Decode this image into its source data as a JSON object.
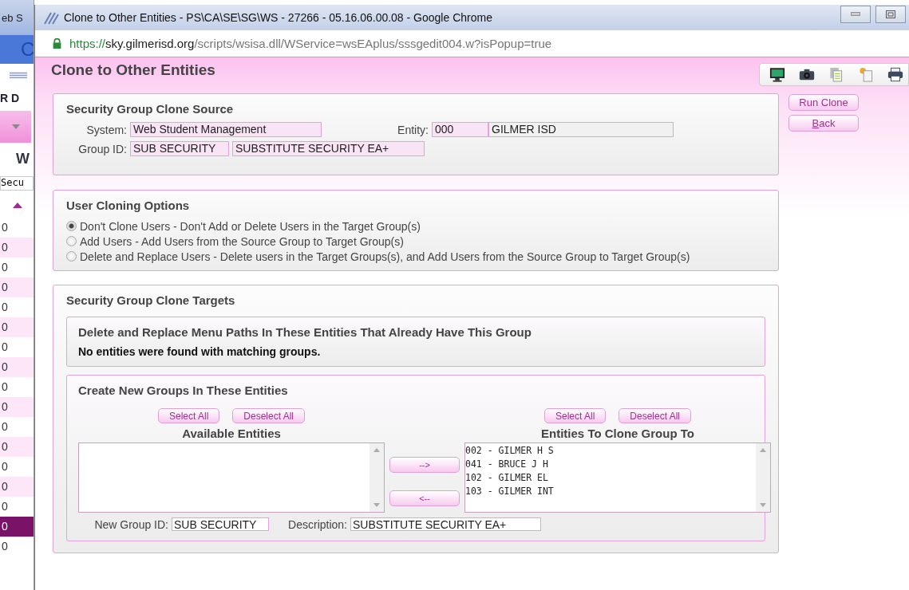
{
  "background_window": {
    "title_fragment": "eb S",
    "logo_fragment": "C",
    "heading_fragment": "R D",
    "link_fragment": "W",
    "field_fragment": "Secu",
    "rows": [
      {
        "text": "0",
        "selected": false
      },
      {
        "text": "0",
        "selected": false
      },
      {
        "text": "0",
        "selected": false
      },
      {
        "text": "0",
        "selected": false
      },
      {
        "text": "0",
        "selected": false
      },
      {
        "text": "0",
        "selected": false
      },
      {
        "text": "0",
        "selected": false
      },
      {
        "text": "0",
        "selected": false
      },
      {
        "text": "0",
        "selected": false
      },
      {
        "text": "0",
        "selected": false
      },
      {
        "text": "0",
        "selected": false
      },
      {
        "text": "0",
        "selected": false
      },
      {
        "text": "0",
        "selected": false
      },
      {
        "text": "0",
        "selected": false
      },
      {
        "text": "0",
        "selected": false
      },
      {
        "text": "0",
        "selected": true
      },
      {
        "text": "0",
        "selected": false
      }
    ]
  },
  "window": {
    "title": "Clone to Other Entities - PS\\CA\\SE\\SG\\WS - 27266 - 05.16.06.00.08 - Google Chrome"
  },
  "address_bar": {
    "scheme": "https://",
    "host": "sky.gilmerisd.org",
    "path": "/scripts/wsisa.dll/WService=wsEAplus/sssgedit004.w?isPopup=true"
  },
  "page": {
    "title": "Clone to Other Entities"
  },
  "actions": [
    {
      "kind": "plain",
      "label": "Run Clone"
    },
    {
      "kind": "access_key",
      "key": "B",
      "rest": "ack"
    }
  ],
  "source": {
    "title": "Security Group Clone Source",
    "system_label": "System:",
    "system_value": "Web Student Management",
    "entity_label": "Entity:",
    "entity_code": "000",
    "entity_name": "GILMER ISD",
    "group_label": "Group ID:",
    "group_id": "SUB SECURITY",
    "group_description": "SUBSTITUTE SECURITY EA+"
  },
  "options": {
    "title": "User Cloning Options",
    "items": [
      {
        "label": "Don't Clone Users - Don't Add or Delete Users in the Target Group(s)",
        "selected": true
      },
      {
        "label": "Add Users - Add Users from the Source Group to Target Group(s)",
        "selected": false
      },
      {
        "label": "Delete and Replace Users - Delete users in the Target Groups(s), and Add Users from the Source Group to Target Group(s)",
        "selected": false
      }
    ]
  },
  "targets": {
    "title": "Security Group Clone Targets",
    "replace_panel": {
      "title": "Delete and Replace Menu Paths In These Entities That Already Have This Group",
      "message": "No entities were found with matching groups."
    },
    "create_panel": {
      "title": "Create New Groups In These Entities",
      "available": {
        "heading": "Available Entities",
        "select_all": "Select All",
        "deselect_all": "Deselect All"
      },
      "move_right": "-->",
      "move_left": "<--",
      "chosen": {
        "heading": "Entities To Clone Group To",
        "select_all": "Select All",
        "deselect_all": "Deselect All",
        "items": [
          "002 - GILMER H S",
          "041 - BRUCE J H",
          "102 - GILMER EL",
          "103 - GILMER INT"
        ]
      },
      "new_group_label": "New Group ID:",
      "new_group_value": "SUB SECURITY",
      "description_label": "Description:",
      "description_value": "SUBSTITUTE SECURITY EA+"
    }
  }
}
